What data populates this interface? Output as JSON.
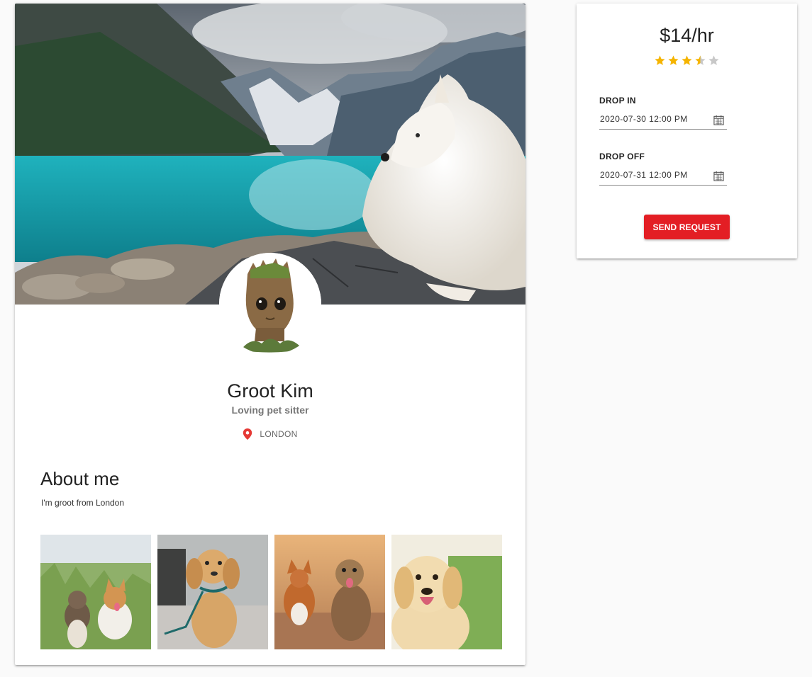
{
  "profile": {
    "name": "Groot Kim",
    "tagline": "Loving pet sitter",
    "location": "LONDON",
    "cover_image": "mountain lake with white dog",
    "avatar_image": "groot figurine"
  },
  "about": {
    "title": "About me",
    "text": "I'm groot from London"
  },
  "gallery": [
    {
      "subject": "two small dogs in grass"
    },
    {
      "subject": "golden spaniel on leash"
    },
    {
      "subject": "corgi and terrier running"
    },
    {
      "subject": "golden retriever puppy"
    }
  ],
  "booking": {
    "price": "$14/hr",
    "rating": 3.5,
    "rating_max": 5,
    "drop_in_label": "DROP IN",
    "drop_in_value": "2020-07-30 12:00 PM",
    "drop_off_label": "DROP OFF",
    "drop_off_value": "2020-07-31 12:00 PM",
    "send_label": "SEND REQUEST"
  },
  "colors": {
    "accent": "#e31e24",
    "star": "#f5b400",
    "star_empty": "#c8c8c8",
    "pin": "#e53935"
  }
}
